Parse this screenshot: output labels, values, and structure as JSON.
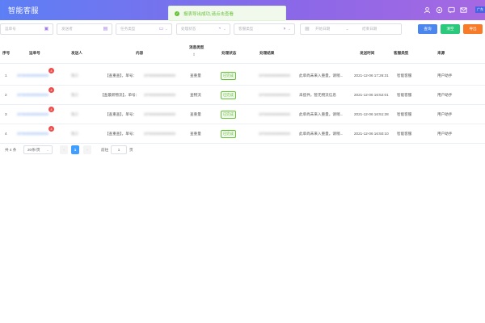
{
  "header": {
    "title": "智能客服",
    "lang_label": "广东"
  },
  "toast": {
    "message": "报表导出成功,请点击查看",
    "icon": "check-circle-icon"
  },
  "filters": {
    "waybill_placeholder": "运单号",
    "sender_placeholder": "发送者",
    "task_type_placeholder": "任务类型",
    "process_status_placeholder": "处理状态",
    "reply_type_placeholder": "客服类型",
    "date_start_placeholder": "开始日期",
    "date_sep": "~",
    "date_end_placeholder": "结束日期",
    "search_label": "查询",
    "reset_label": "清空",
    "export_label": "导出"
  },
  "table": {
    "headers": {
      "index": "序号",
      "waybill": "运单号",
      "sender": "发送人",
      "content": "内容",
      "message_type": "消息类型",
      "sort_icon": "⇕",
      "process_status": "处理状态",
      "process_result": "处理结果",
      "send_time": "发送时间",
      "service_type": "客服类型",
      "source": "来源"
    },
    "rows": [
      {
        "index": "1",
        "waybill": "SF0000000000000",
        "badge": "4",
        "sender": "张三",
        "content_prefix": "【查重查】，单号：",
        "content_code": "SF0000000000000",
        "message_type": "查重量",
        "status": "已完成",
        "result_code": "SF0000000000000",
        "result_text": "此单尚未来入重量。请稍...",
        "send_time": "2021-12-06 17:26:31",
        "service_type": "智能客服",
        "source": "用户助手"
      },
      {
        "index": "2",
        "waybill": "SF0000000000000",
        "badge": "4",
        "sender": "张三",
        "content_prefix": "【查最新物流】，单号：",
        "content_code": "SF0000000000000",
        "message_type": "查物流",
        "status": "已完成",
        "result_code": "SF0000000000000",
        "result_text": "未揽件。暂无物流信息",
        "send_time": "2021-12-06 16:52:01",
        "service_type": "智能客服",
        "source": "用户助手"
      },
      {
        "index": "3",
        "waybill": "SF0000000000000",
        "badge": "4",
        "sender": "张三",
        "content_prefix": "【查重查】，单号：",
        "content_code": "SF0000000000000",
        "message_type": "查重量",
        "status": "已完成",
        "result_code": "SF0000000000000",
        "result_text": "此单尚未来入重量。请稍...",
        "send_time": "2021-12-06 16:51:28",
        "service_type": "智能客服",
        "source": "用户助手"
      },
      {
        "index": "4",
        "waybill": "SF0000000000000",
        "badge": "4",
        "sender": "张三",
        "content_prefix": "【查重查】，单号：",
        "content_code": "SF0000000000000",
        "message_type": "查重量",
        "status": "已完成",
        "result_code": "SF0000000000000",
        "result_text": "此单尚未来入重量。请稍...",
        "send_time": "2021-12-06 16:50:10",
        "service_type": "智能客服",
        "source": "用户助手"
      }
    ]
  },
  "pager": {
    "total_text": "共 4 条",
    "page_size": "20条/页",
    "prev_icon": "‹",
    "current_page": "1",
    "next_icon": "›",
    "goto_prefix": "前往",
    "goto_value": "1",
    "goto_suffix": "页"
  },
  "colors": {
    "header_start": "#5d7ff5",
    "header_end": "#a668e2",
    "search_btn": "#4a86ee",
    "reset_btn": "#2bc97b",
    "export_btn": "#f77b28",
    "success": "#67c23a",
    "badge": "#f04c4c"
  }
}
